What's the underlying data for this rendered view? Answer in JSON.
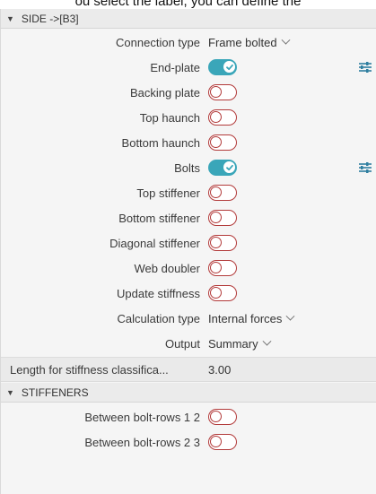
{
  "caption": "ou select the label, you can define the",
  "section_side": {
    "title": "SIDE ->[B3]"
  },
  "rows": {
    "connection_type": {
      "label": "Connection type",
      "value": "Frame bolted"
    },
    "end_plate": {
      "label": "End-plate",
      "on": true
    },
    "backing_plate": {
      "label": "Backing plate",
      "on": false
    },
    "top_haunch": {
      "label": "Top haunch",
      "on": false
    },
    "bottom_haunch": {
      "label": "Bottom haunch",
      "on": false
    },
    "bolts": {
      "label": "Bolts",
      "on": true
    },
    "top_stiffener": {
      "label": "Top stiffener",
      "on": false
    },
    "bottom_stiffener": {
      "label": "Bottom stiffener",
      "on": false
    },
    "diagonal_stiffener": {
      "label": "Diagonal stiffener",
      "on": false
    },
    "web_doubler": {
      "label": "Web doubler",
      "on": false
    },
    "update_stiffness": {
      "label": "Update stiffness",
      "on": false
    },
    "calculation_type": {
      "label": "Calculation type",
      "value": "Internal forces"
    },
    "output": {
      "label": "Output",
      "value": "Summary"
    },
    "length_stiffness": {
      "label": "Length for stiffness classifica...",
      "value": "3.00"
    }
  },
  "section_stiffeners": {
    "title": "STIFFENERS"
  },
  "stiffener_rows": [
    {
      "label": "Between bolt-rows 1 2",
      "on": false
    },
    {
      "label": "Between bolt-rows 2 3",
      "on": false
    }
  ],
  "colors": {
    "toggle_on": "#3aa6b9",
    "toggle_off": "#b23a3a"
  },
  "icons": {
    "collapse": "triangle-down-icon",
    "dropdown": "chevron-down-icon",
    "settings": "sliders-icon",
    "check": "check-icon"
  }
}
